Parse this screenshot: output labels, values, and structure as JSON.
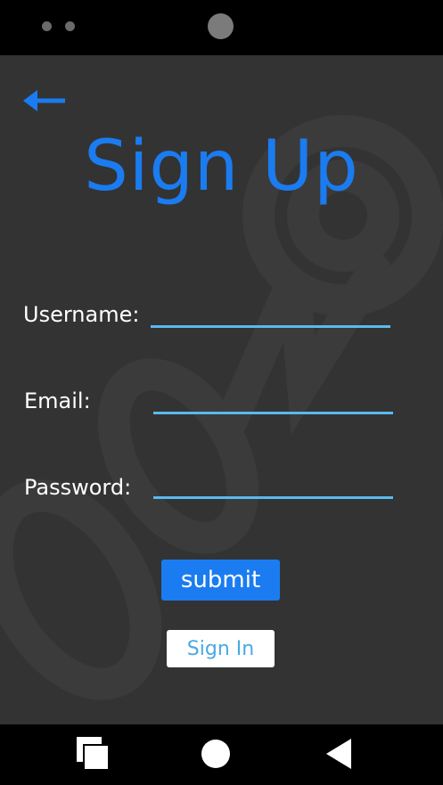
{
  "header": {
    "back_icon": "arrow-left-icon",
    "title": "Sign Up"
  },
  "form": {
    "username_label": "Username:",
    "username_value": "",
    "email_label": "Email:",
    "email_value": "",
    "password_label": "Password:",
    "password_value": "",
    "submit_label": "submit",
    "signin_label": "Sign In"
  },
  "nav": {
    "recent_icon": "recent-apps-icon",
    "home_icon": "home-circle-icon",
    "back_icon": "back-triangle-icon"
  },
  "colors": {
    "accent": "#1a7cf0",
    "input_underline": "#5ab9ee",
    "screen_background": "#333333",
    "signin_text": "#4aa8e6"
  }
}
